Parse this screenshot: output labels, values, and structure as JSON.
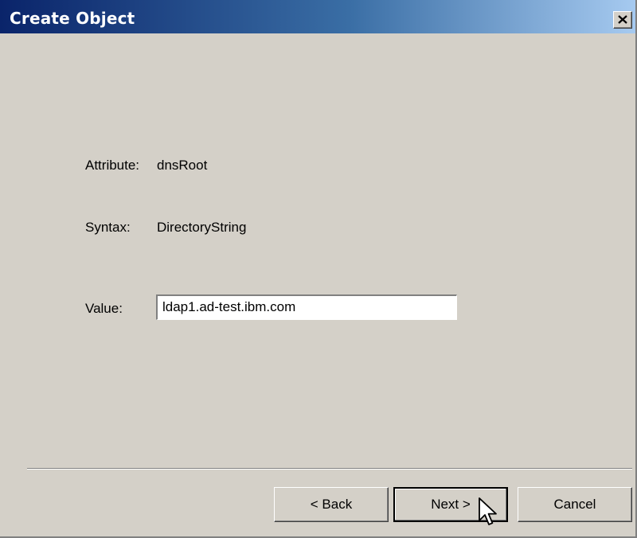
{
  "window": {
    "title": "Create Object",
    "close_icon": "close-icon"
  },
  "form": {
    "attribute_label": "Attribute:",
    "attribute_value": "dnsRoot",
    "syntax_label": "Syntax:",
    "syntax_value": "DirectoryString",
    "value_label": "Value:",
    "value_input": "ldap1.ad-test.ibm.com"
  },
  "buttons": {
    "back": "< Back",
    "next": "Next >",
    "cancel": "Cancel"
  },
  "colors": {
    "title_gradient_start": "#0a246a",
    "title_gradient_end": "#a6caf0",
    "dialog_face": "#d4d0c8"
  }
}
